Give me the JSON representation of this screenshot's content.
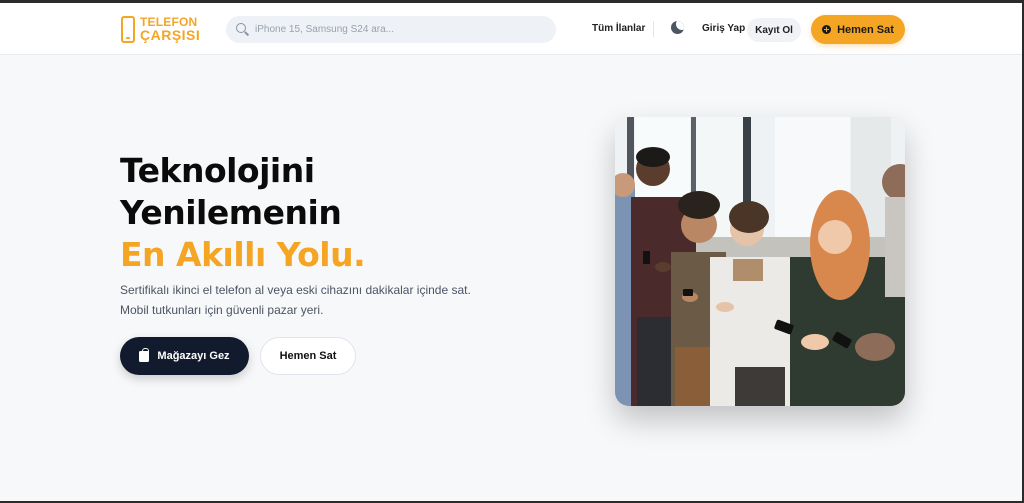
{
  "brand": {
    "line1": "TELEFON",
    "line2": "ÇARŞISI",
    "color": "#f5a524"
  },
  "search": {
    "placeholder": "iPhone 15, Samsung S24 ara..."
  },
  "nav": {
    "all_listings": "Tüm İlanlar",
    "theme_toggle_icon": "moon-icon",
    "login": "Giriş Yap",
    "register": "Kayıt Ol",
    "sell_now": "Hemen Sat"
  },
  "hero": {
    "title_line1": "Teknolojini",
    "title_line2": "Yenilemenin",
    "title_line3": "En Akıllı Yolu.",
    "description": "Sertifikalı ikinci el telefon al veya eski cihazını dakikalar içinde sat. Mobil tutkunları için güvenli pazar yeri.",
    "primary_button": "Mağazayı Gez",
    "secondary_button": "Hemen Sat",
    "image_alt": "Group of people using smartphones"
  },
  "colors": {
    "accent": "#f5a524",
    "dark": "#121a2e",
    "background": "#f7f8fa"
  }
}
